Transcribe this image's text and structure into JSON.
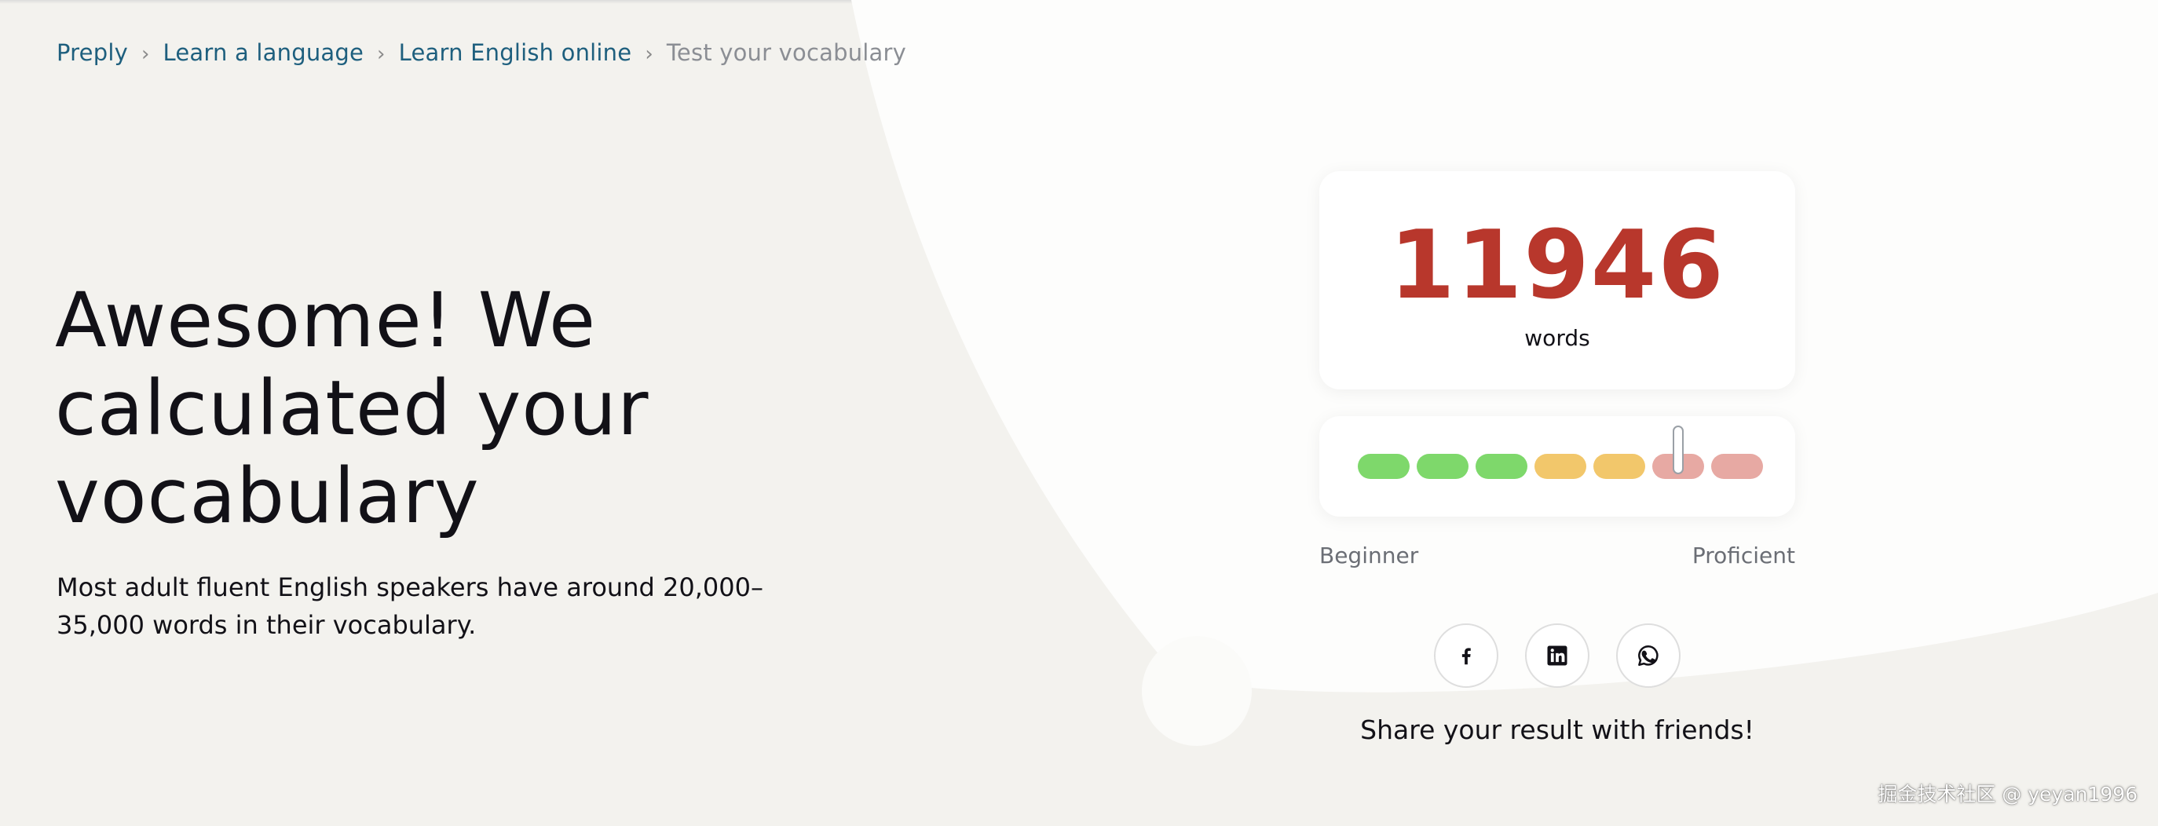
{
  "breadcrumb": {
    "items": [
      {
        "label": "Preply"
      },
      {
        "label": "Learn a language"
      },
      {
        "label": "Learn English online"
      }
    ],
    "current": "Test your vocabulary",
    "separator": "›"
  },
  "hero": {
    "title": "Awesome! We calculated your vocabulary",
    "description": "Most adult fluent English speakers have around 20,000–35,000 words in their vocabulary."
  },
  "result": {
    "score": "11946",
    "unit": "words",
    "score_color": "#b8372c",
    "level_scale": {
      "segments": [
        {
          "color": "#7ed86b"
        },
        {
          "color": "#7ed86b"
        },
        {
          "color": "#7ed86b"
        },
        {
          "color": "#f2c76b"
        },
        {
          "color": "#f2c76b"
        },
        {
          "color": "#e7a9a3"
        },
        {
          "color": "#e7a9a3"
        }
      ],
      "marker_position_fraction": 0.79,
      "min_label": "Beginner",
      "max_label": "Proficient"
    }
  },
  "share": {
    "buttons": [
      {
        "name": "facebook",
        "icon": "facebook-icon"
      },
      {
        "name": "linkedin",
        "icon": "linkedin-icon"
      },
      {
        "name": "whatsapp",
        "icon": "whatsapp-icon"
      }
    ],
    "text": "Share your result with friends!"
  },
  "watermark": "掘金技术社区 @ yeyan1996"
}
